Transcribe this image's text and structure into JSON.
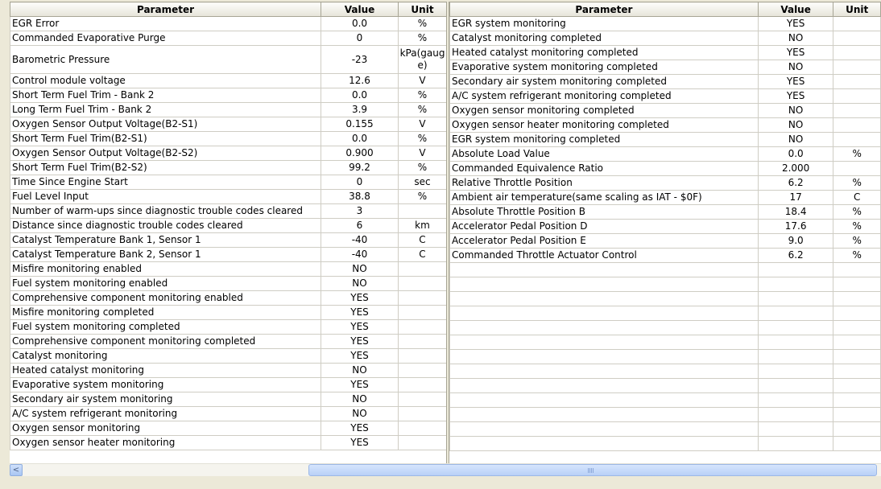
{
  "left_table": {
    "headers": [
      "Parameter",
      "Value",
      "Unit"
    ],
    "rows": [
      [
        "EGR Error",
        "0.0",
        "%"
      ],
      [
        "Commanded Evaporative Purge",
        "0",
        "%"
      ],
      [
        "Barometric Pressure",
        "-23",
        "kPa(gauge)"
      ],
      [
        "Control module voltage",
        "12.6",
        "V"
      ],
      [
        "Short Term Fuel Trim - Bank 2",
        "0.0",
        "%"
      ],
      [
        "Long Term Fuel Trim - Bank 2",
        "3.9",
        "%"
      ],
      [
        "Oxygen Sensor Output Voltage(B2-S1)",
        "0.155",
        "V"
      ],
      [
        "Short Term Fuel Trim(B2-S1)",
        "0.0",
        "%"
      ],
      [
        "Oxygen Sensor Output Voltage(B2-S2)",
        "0.900",
        "V"
      ],
      [
        "Short Term Fuel Trim(B2-S2)",
        "99.2",
        "%"
      ],
      [
        "Time Since Engine Start",
        "0",
        "sec"
      ],
      [
        "Fuel Level Input",
        "38.8",
        "%"
      ],
      [
        "Number of warm-ups since diagnostic trouble codes cleared",
        "3",
        ""
      ],
      [
        "Distance since diagnostic trouble codes cleared",
        "6",
        "km"
      ],
      [
        "Catalyst Temperature Bank 1, Sensor 1",
        "-40",
        "C"
      ],
      [
        "Catalyst Temperature Bank 2, Sensor 1",
        "-40",
        "C"
      ],
      [
        "Misfire monitoring enabled",
        "NO",
        ""
      ],
      [
        "Fuel system monitoring enabled",
        "NO",
        ""
      ],
      [
        "Comprehensive component monitoring enabled",
        "YES",
        ""
      ],
      [
        "Misfire monitoring completed",
        "YES",
        ""
      ],
      [
        "Fuel system monitoring completed",
        "YES",
        ""
      ],
      [
        "Comprehensive component monitoring completed",
        "YES",
        ""
      ],
      [
        "Catalyst monitoring",
        "YES",
        ""
      ],
      [
        "Heated catalyst monitoring",
        "NO",
        ""
      ],
      [
        "Evaporative system monitoring",
        "YES",
        ""
      ],
      [
        "Secondary air system monitoring",
        "NO",
        ""
      ],
      [
        "A/C system refrigerant monitoring",
        "NO",
        ""
      ],
      [
        "Oxygen sensor monitoring",
        "YES",
        ""
      ],
      [
        "Oxygen sensor heater monitoring",
        "YES",
        ""
      ]
    ]
  },
  "right_table": {
    "headers": [
      "Parameter",
      "Value",
      "Unit"
    ],
    "rows": [
      [
        "EGR system monitoring",
        "YES",
        ""
      ],
      [
        "Catalyst monitoring completed",
        "NO",
        ""
      ],
      [
        "Heated catalyst monitoring completed",
        "YES",
        ""
      ],
      [
        "Evaporative system monitoring completed",
        "NO",
        ""
      ],
      [
        "Secondary air system monitoring completed",
        "YES",
        ""
      ],
      [
        "A/C system refrigerant monitoring completed",
        "YES",
        ""
      ],
      [
        "Oxygen sensor monitoring completed",
        "NO",
        ""
      ],
      [
        "Oxygen sensor heater monitoring completed",
        "NO",
        ""
      ],
      [
        "EGR system monitoring completed",
        "NO",
        ""
      ],
      [
        "Absolute Load Value",
        "0.0",
        "%"
      ],
      [
        "Commanded Equivalence Ratio",
        "2.000",
        ""
      ],
      [
        "Relative Throttle Position",
        "6.2",
        "%"
      ],
      [
        "Ambient air temperature(same scaling as IAT - $0F)",
        "17",
        "C"
      ],
      [
        "Absolute Throttle Position B",
        "18.4",
        "%"
      ],
      [
        "Accelerator Pedal Position D",
        "17.6",
        "%"
      ],
      [
        "Accelerator Pedal Position E",
        "9.0",
        "%"
      ],
      [
        "Commanded Throttle Actuator Control",
        "6.2",
        "%"
      ]
    ],
    "empty_rows": 13
  },
  "scrollbar": {
    "left_arrow": "<"
  }
}
